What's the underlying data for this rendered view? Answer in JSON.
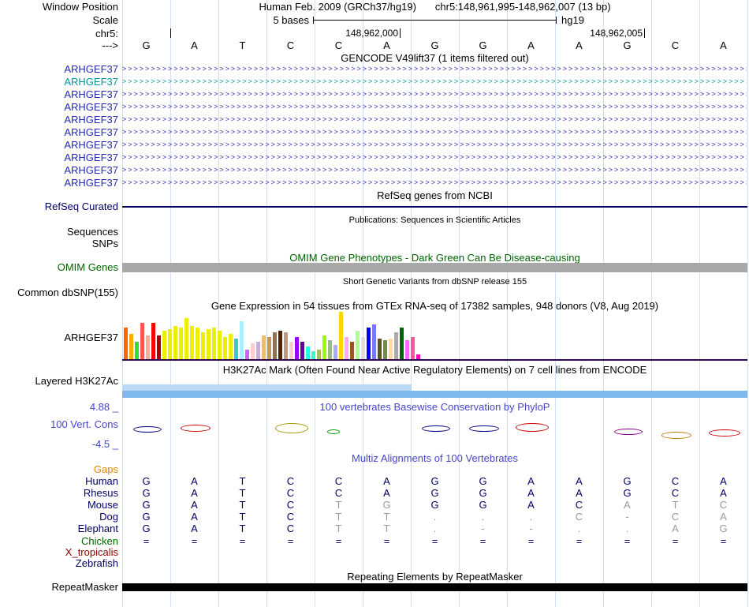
{
  "header": {
    "window_position_label": "Window Position",
    "assembly_title": "Human Feb. 2009 (GRCh37/hg19)",
    "position_title": "chr5:148,961,995-148,962,007 (13 bp)",
    "scale_label": "Scale",
    "scale_value": "5 bases",
    "genome": "hg19",
    "chrom_label": "chr5:",
    "ruler_ticks": [
      "148,962,000",
      "148,962,005"
    ],
    "strand_label": "--->",
    "bases": [
      "G",
      "A",
      "T",
      "C",
      "C",
      "A",
      "G",
      "G",
      "A",
      "A",
      "G",
      "C",
      "A"
    ]
  },
  "gencode": {
    "title": "GENCODE V49lift37 (1 items filtered out)",
    "transcripts": [
      {
        "label": "ARHGEF37",
        "color": "#2929b8"
      },
      {
        "label": "ARHGEF37",
        "color": "#009898"
      },
      {
        "label": "ARHGEF37",
        "color": "#2929b8"
      },
      {
        "label": "ARHGEF37",
        "color": "#2929b8"
      },
      {
        "label": "ARHGEF37",
        "color": "#2929b8"
      },
      {
        "label": "ARHGEF37",
        "color": "#2929b8"
      },
      {
        "label": "ARHGEF37",
        "color": "#2929b8"
      },
      {
        "label": "ARHGEF37",
        "color": "#2929b8"
      },
      {
        "label": "ARHGEF37",
        "color": "#2929b8"
      },
      {
        "label": "ARHGEF37",
        "color": "#2929b8"
      }
    ]
  },
  "refseq": {
    "title": "RefSeq genes from NCBI",
    "label": "RefSeq Curated",
    "color": "#000064"
  },
  "publications": {
    "title": "Publications: Sequences in Scientific Articles",
    "row_labels": [
      "Sequences",
      "SNPs"
    ]
  },
  "omim": {
    "title": "OMIM Gene Phenotypes - Dark Green Can Be Disease-causing",
    "label": "OMIM Genes",
    "title_color": "#006400",
    "bar_color": "#a8a8a8"
  },
  "dbsnp": {
    "title": "Short Genetic Variants from dbSNP release 155",
    "label": "Common dbSNP(155)"
  },
  "gtex": {
    "title": "Gene Expression in 54 tissues from GTEx RNA-seq of 17382 samples, 948 donors (V8, Aug 2019)",
    "label": "ARHGEF37",
    "baseline_color": "#2d0a4e"
  },
  "h3k27ac": {
    "title": "H3K27Ac Mark (Often Found Near Active Regulatory Elements) on 7 cell lines from ENCODE",
    "label": "Layered H3K27Ac",
    "colors": [
      "#b9d9f6",
      "#7db9ec"
    ]
  },
  "phylop": {
    "title": "100 vertebrates Basewise Conservation by PhyloP",
    "label": "100 Vert. Cons",
    "max_label": "4.88 _",
    "min_label": "-4.5 _",
    "color": "#4646c8",
    "marks": [
      {
        "col": 1,
        "color": "#000080",
        "w": 34,
        "h": 6,
        "dy": 2
      },
      {
        "col": 2,
        "color": "#cc0000",
        "w": 36,
        "h": 7,
        "dy": 0
      },
      {
        "col": 4,
        "color": "#9a9a00",
        "w": 40,
        "h": 11,
        "dy": -2
      },
      {
        "col": 5,
        "color": "#009900",
        "w": 14,
        "h": 4,
        "dy": 6,
        "dx": -8
      },
      {
        "col": 7,
        "color": "#000080",
        "w": 34,
        "h": 6,
        "dy": 1
      },
      {
        "col": 8,
        "color": "#000080",
        "w": 36,
        "h": 6,
        "dy": 1
      },
      {
        "col": 9,
        "color": "#cc0000",
        "w": 40,
        "h": 9,
        "dy": -2
      },
      {
        "col": 11,
        "color": "#880088",
        "w": 34,
        "h": 6,
        "dy": 5
      },
      {
        "col": 12,
        "color": "#bb7700",
        "w": 36,
        "h": 7,
        "dy": 9
      },
      {
        "col": 13,
        "color": "#cc0000",
        "w": 38,
        "h": 7,
        "dy": 6
      }
    ]
  },
  "multiz": {
    "title": "Multiz Alignments of 100 Vertebrates",
    "gaps_label": "Gaps",
    "rows": [
      {
        "name": "Human",
        "color": "#000064",
        "cells": [
          [
            "G",
            0
          ],
          [
            "A",
            0
          ],
          [
            "T",
            0
          ],
          [
            "C",
            0
          ],
          [
            "C",
            0
          ],
          [
            "A",
            0
          ],
          [
            "G",
            0
          ],
          [
            "G",
            0
          ],
          [
            "A",
            0
          ],
          [
            "A",
            0
          ],
          [
            "G",
            0
          ],
          [
            "C",
            0
          ],
          [
            "A",
            0
          ]
        ]
      },
      {
        "name": "Rhesus",
        "color": "#000064",
        "cells": [
          [
            "G",
            0
          ],
          [
            "A",
            0
          ],
          [
            "T",
            0
          ],
          [
            "C",
            0
          ],
          [
            "C",
            0
          ],
          [
            "A",
            0
          ],
          [
            "G",
            0
          ],
          [
            "G",
            0
          ],
          [
            "A",
            0
          ],
          [
            "A",
            0
          ],
          [
            "G",
            0
          ],
          [
            "C",
            0
          ],
          [
            "A",
            0
          ]
        ]
      },
      {
        "name": "Mouse",
        "color": "#000064",
        "cells": [
          [
            "G",
            0
          ],
          [
            "A",
            0
          ],
          [
            "T",
            0
          ],
          [
            "C",
            0
          ],
          [
            "T",
            1
          ],
          [
            "G",
            1
          ],
          [
            "G",
            0
          ],
          [
            "G",
            0
          ],
          [
            "A",
            0
          ],
          [
            "C",
            0
          ],
          [
            "A",
            1
          ],
          [
            "T",
            1
          ],
          [
            "C",
            1
          ]
        ]
      },
      {
        "name": "Dog",
        "color": "#000064",
        "cells": [
          [
            "G",
            0
          ],
          [
            "A",
            0
          ],
          [
            "T",
            0
          ],
          [
            "C",
            0
          ],
          [
            "T",
            1
          ],
          [
            "T",
            1
          ],
          [
            ".",
            1
          ],
          [
            ".",
            1
          ],
          [
            ".",
            1
          ],
          [
            "C",
            1
          ],
          [
            "-",
            1
          ],
          [
            "C",
            1
          ],
          [
            "A",
            1
          ]
        ]
      },
      {
        "name": "Elephant",
        "color": "#000064",
        "cells": [
          [
            "G",
            0
          ],
          [
            "A",
            0
          ],
          [
            "T",
            0
          ],
          [
            "C",
            0
          ],
          [
            "T",
            1
          ],
          [
            "T",
            1
          ],
          [
            ".",
            1
          ],
          [
            "-",
            1
          ],
          [
            "-",
            1
          ],
          [
            ".",
            1
          ],
          [
            ".",
            1
          ],
          [
            "A",
            1
          ],
          [
            "G",
            1
          ]
        ]
      },
      {
        "name": "Chicken",
        "color": "#006400",
        "cells": [
          [
            "=",
            0
          ],
          [
            "=",
            0
          ],
          [
            "=",
            0
          ],
          [
            "=",
            0
          ],
          [
            "=",
            0
          ],
          [
            "=",
            0
          ],
          [
            "=",
            0
          ],
          [
            "=",
            0
          ],
          [
            "=",
            0
          ],
          [
            "=",
            0
          ],
          [
            "=",
            0
          ],
          [
            "=",
            0
          ],
          [
            "=",
            0
          ]
        ]
      },
      {
        "name": "X_tropicalis",
        "color": "#8b0000",
        "cells": [
          [
            "",
            0
          ],
          [
            "",
            0
          ],
          [
            "",
            0
          ],
          [
            "",
            0
          ],
          [
            "",
            0
          ],
          [
            "",
            0
          ],
          [
            "",
            0
          ],
          [
            "",
            0
          ],
          [
            "",
            0
          ],
          [
            "",
            0
          ],
          [
            "",
            0
          ],
          [
            "",
            0
          ],
          [
            "",
            0
          ]
        ]
      },
      {
        "name": "Zebrafish",
        "color": "#000064",
        "cells": [
          [
            "",
            0
          ],
          [
            "",
            0
          ],
          [
            "",
            0
          ],
          [
            "",
            0
          ],
          [
            "",
            0
          ],
          [
            "",
            0
          ],
          [
            "",
            0
          ],
          [
            "",
            0
          ],
          [
            "",
            0
          ],
          [
            "",
            0
          ],
          [
            "",
            0
          ],
          [
            "",
            0
          ],
          [
            "",
            0
          ]
        ]
      }
    ]
  },
  "repeatmasker": {
    "title": "Repeating Elements by RepeatMasker",
    "label": "RepeatMasker"
  },
  "chart_data": {
    "type": "bar",
    "title": "Gene Expression in 54 tissues from GTEx RNA-seq of 17382 samples, 948 donors (V8, Aug 2019)",
    "series": [
      {
        "name": "ARHGEF37",
        "values": [
          40,
          32,
          22,
          46,
          30,
          46,
          30,
          36,
          38,
          42,
          40,
          52,
          42,
          40,
          34,
          38,
          40,
          36,
          28,
          32,
          26,
          48,
          12,
          20,
          22,
          30,
          28,
          34,
          36,
          34,
          22,
          28,
          22,
          16,
          10,
          12,
          30,
          24,
          18,
          60,
          28,
          22,
          36,
          28,
          40,
          44,
          26,
          24,
          26,
          34,
          40,
          24,
          28,
          6
        ]
      }
    ],
    "colors": [
      "#FF6600",
      "#FFAA00",
      "#33DD33",
      "#FF5555",
      "#FFAA99",
      "#FF0000",
      "#AA0000",
      "#EEEE00",
      "#EEEE00",
      "#EEEE00",
      "#EEEE00",
      "#EEEE00",
      "#EEEE00",
      "#EEEE00",
      "#EEEE00",
      "#EEEE00",
      "#EEEE00",
      "#EEEE00",
      "#EEEE00",
      "#EEEE00",
      "#33CCCC",
      "#AAEEFF",
      "#CC66FF",
      "#FFCCCC",
      "#CCAADD",
      "#EEBB77",
      "#CC9955",
      "#8B7355",
      "#552200",
      "#BB9988",
      "#FFCCCC",
      "#9900FF",
      "#660099",
      "#22FFDD",
      "#33FFC2",
      "#AABB66",
      "#99FF00",
      "#99BB88",
      "#AAAAFF",
      "#FFD700",
      "#FFAAFF",
      "#995522",
      "#AAFF99",
      "#DDDDDD",
      "#0000FF",
      "#7777FF",
      "#555522",
      "#778855",
      "#FFDD99",
      "#AAAAAA",
      "#006600",
      "#FF66FF",
      "#FF5599",
      "#FF00BB"
    ]
  }
}
